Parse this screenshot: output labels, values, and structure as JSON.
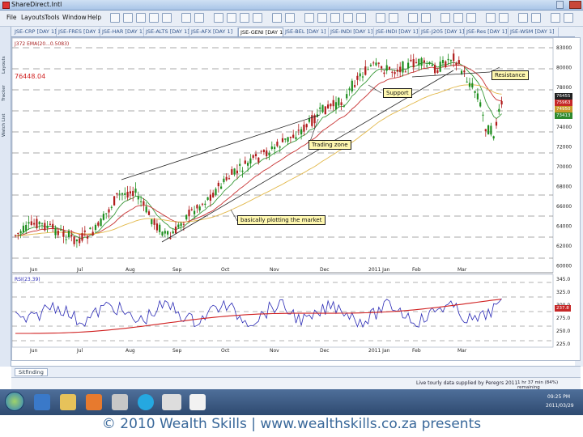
{
  "window": {
    "title": "ShareDirect.Intl"
  },
  "menu": [
    "File",
    "Layouts",
    "Tools",
    "Window",
    "Help"
  ],
  "tabs": [
    "JSE-CRP [DAY 1]",
    "JSE-FRES [DAY 1]",
    "JSE-HAR [DAY 1]",
    "JSE-ALTS [DAY 1]",
    "JSE-AFX [DAY 1]",
    "JSE-GENI [DAY 1]",
    "JSE-BEL [DAY 1]",
    "JSE-INDI [DAY 1]",
    "JSE-INDI [DAY 1]",
    "JSE-J205 [DAY 1]",
    "JSE-Res [DAY 1]",
    "JSE-WSM [DAY 1]"
  ],
  "active_tab_index": 5,
  "left_tabs": [
    "Layouts",
    "Tracker",
    "Watch List"
  ],
  "chart": {
    "header_text": "J372 EMA(20...0.5083)",
    "price_label": "76448.04",
    "x_labels": [
      "Jun",
      "Jul",
      "Aug",
      "Sep",
      "Oct",
      "Nov",
      "Dec",
      "2011 Jan",
      "Feb",
      "Mar"
    ],
    "y_labels": [
      "83000",
      "80000",
      "78000",
      "76000",
      "74000",
      "72000",
      "70000",
      "68000",
      "66000",
      "64000",
      "62000",
      "60000"
    ],
    "price_tags": [
      "76455",
      "75963",
      "74950",
      "73413"
    ],
    "callouts": {
      "resistance": "Resistance",
      "support": "Support",
      "trading_zone": "Trading zone",
      "basically": "basically plotting the market"
    }
  },
  "indicator": {
    "header_text": "RSI(23.39)",
    "y_labels": [
      "345.0",
      "325.0",
      "300.0",
      "275.0",
      "250.0",
      "225.0"
    ],
    "value_tag": "237.8",
    "x_labels": [
      "Jun",
      "Jul",
      "Aug",
      "Sep",
      "Oct",
      "Nov",
      "Dec",
      "2011 Jan",
      "Feb",
      "Mar"
    ]
  },
  "bottom_tab": "Sitfinding",
  "status": {
    "text": "Live tourly data supplied by Peregrs",
    "time_remaining": "1 hr 37 min (84%) remaining",
    "date_label": "2011"
  },
  "tray": {
    "time": "09:25 PM",
    "date": "2011/03/29"
  },
  "footer": "© 2010 Wealth Skills | www.wealthskills.co.za presents",
  "colors": {
    "ema_red": "#c83232",
    "ema_green": "#3a9a3a",
    "ema_yellow": "#e2b84a",
    "candle_up": "#1f8f1f",
    "candle_down": "#b01c1c",
    "trendline": "#222222",
    "rsi_blue": "#2a2ab5",
    "rsi_red": "#d02020"
  }
}
